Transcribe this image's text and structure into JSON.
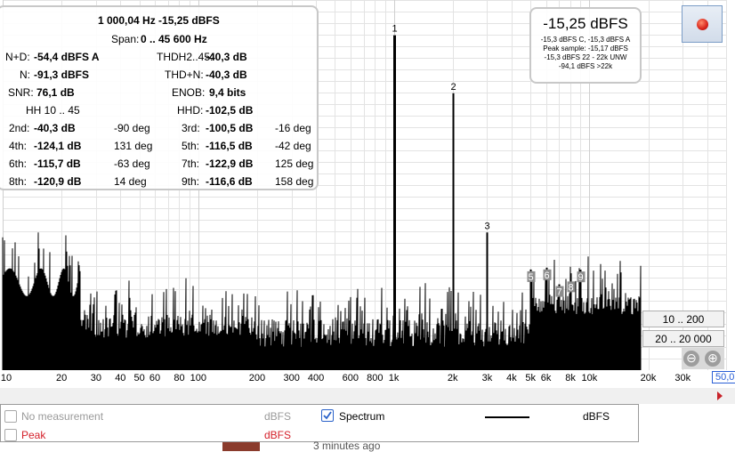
{
  "chart_data": {
    "type": "line",
    "xscale": "log",
    "xlim": [
      10,
      50000
    ],
    "ylim": [
      -160,
      0
    ],
    "xlabel": "",
    "ylabel": "dBFS",
    "grid": true,
    "x_ticks": [
      "10",
      "20",
      "30",
      "40",
      "50",
      "60",
      "80",
      "100",
      "200",
      "300",
      "400",
      "600",
      "800",
      "1k",
      "2k",
      "3k",
      "4k",
      "5k",
      "6k",
      "8k",
      "10k",
      "20k",
      "30k"
    ],
    "x_tick_values": [
      10,
      20,
      30,
      40,
      50,
      60,
      80,
      100,
      200,
      300,
      400,
      600,
      800,
      1000,
      2000,
      3000,
      4000,
      5000,
      6000,
      8000,
      10000,
      20000,
      30000
    ],
    "x_max_label": "50,0k",
    "series": [
      {
        "name": "Spectrum"
      }
    ],
    "harmonic_markers": [
      {
        "label": "1",
        "freq": 1000,
        "level": -15.25
      },
      {
        "label": "2",
        "freq": 2000,
        "level": -40.3
      },
      {
        "label": "3",
        "freq": 3000,
        "level": -100.5
      },
      {
        "label": "5",
        "freq": 5000,
        "level": -116.5
      },
      {
        "label": "6",
        "freq": 6000,
        "level": -115.7
      },
      {
        "label": "7",
        "freq": 7000,
        "level": -122.9
      },
      {
        "label": "8",
        "freq": 8000,
        "level": -120.9
      },
      {
        "label": "9",
        "freq": 9000,
        "level": -116.6
      }
    ]
  },
  "measurements": {
    "fundamental": "1 000,04 Hz  -15,25 dBFS",
    "span_label": "Span:",
    "span_value": "0 .. 45 600 Hz",
    "nd_label": "N+D:",
    "nd_value": "-54,4 dBFS A",
    "thd_label": "THDH2..45:",
    "thd_value": "-40,3 dB",
    "n_label": "N:",
    "n_value": "-91,3 dBFS",
    "thdn_label": "THD+N:",
    "thdn_value": "-40,3 dB",
    "snr_label": "SNR:",
    "snr_value": "76,1 dB",
    "enob_label": "ENOB:",
    "enob_value": "9,4 bits",
    "hh_label": "HH 10 .. 45",
    "hhd_label": "HHD:",
    "hhd_value": "-102,5 dB",
    "harmonics": [
      {
        "label": "2nd:",
        "value": "-40,3 dB",
        "phase": "-90 deg"
      },
      {
        "label": "3rd:",
        "value": "-100,5 dB",
        "phase": "-16 deg"
      },
      {
        "label": "4th:",
        "value": "-124,1 dB",
        "phase": "131 deg"
      },
      {
        "label": "5th:",
        "value": "-116,5 dB",
        "phase": "-42 deg"
      },
      {
        "label": "6th:",
        "value": "-115,7 dB",
        "phase": "-63 deg"
      },
      {
        "label": "7th:",
        "value": "-122,9 dB",
        "phase": "125 deg"
      },
      {
        "label": "8th:",
        "value": "-120,9 dB",
        "phase": "14 deg"
      },
      {
        "label": "9th:",
        "value": "-116,6 dB",
        "phase": "158 deg"
      }
    ]
  },
  "level": {
    "big": "-15,25 dBFS",
    "line1": "-15,3 dBFS C, -15,3 dBFS A",
    "line2": "Peak sample: -15,17 dBFS",
    "line3": "-15,3 dBFS 22 - 22k UNW",
    "line4": "-94,1 dBFS >22k"
  },
  "range_buttons": {
    "b1": "10 .. 200",
    "b2": "20 .. 20 000"
  },
  "zoom": {
    "minus": "⊖",
    "plus": "⊕"
  },
  "legend": {
    "row1_label": "No measurement",
    "row1_unit": "dBFS",
    "row2_label": "Peak",
    "row2_unit": "dBFS",
    "spectrum_label": "Spectrum",
    "spectrum_unit": "dBFS",
    "peak_color": "#d4202a",
    "muted_color": "#9a9a9a"
  },
  "below_text": "3 minutes ago"
}
